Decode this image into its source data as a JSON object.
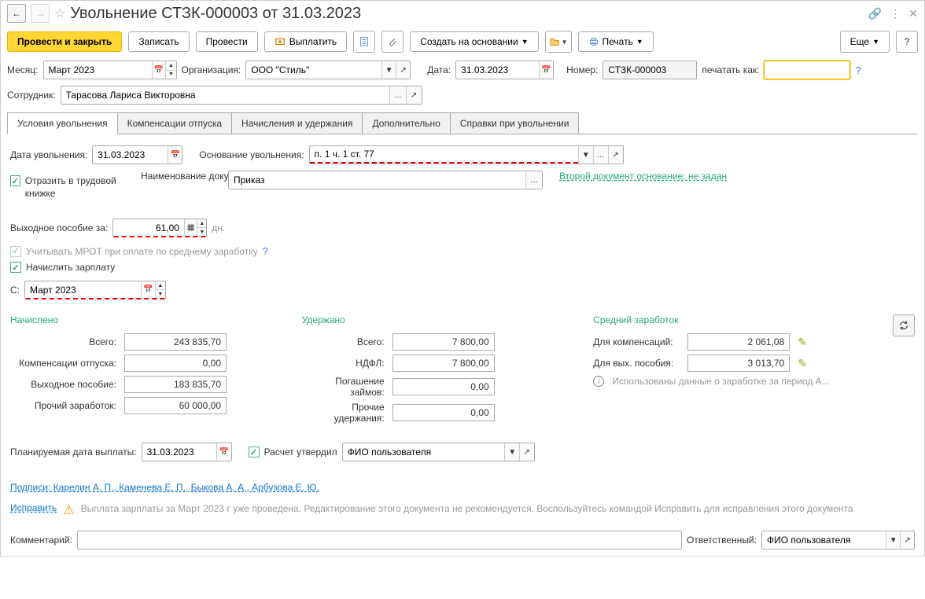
{
  "title": "Увольнение СТЗК-000003 от 31.03.2023",
  "toolbar": {
    "post_close": "Провести и закрыть",
    "save": "Записать",
    "post": "Провести",
    "pay": "Выплатить",
    "create_based": "Создать на основании",
    "print": "Печать",
    "more": "Еще"
  },
  "header": {
    "month_label": "Месяц:",
    "month_value": "Март 2023",
    "org_label": "Организация:",
    "org_value": "ООО \"Стиль\"",
    "date_label": "Дата:",
    "date_value": "31.03.2023",
    "number_label": "Номер:",
    "number_value": "СТЗК-000003",
    "print_as_label": "печатать как:",
    "print_as_value": "",
    "employee_label": "Сотрудник:",
    "employee_value": "Тарасова Лариса Викторовна"
  },
  "tabs": [
    "Условия увольнения",
    "Компенсации отпуска",
    "Начисления и удержания",
    "Дополнительно",
    "Справки при увольнении"
  ],
  "conditions": {
    "dismiss_date_label": "Дата увольнения:",
    "dismiss_date_value": "31.03.2023",
    "basis_label": "Основание увольнения:",
    "basis_value": "п. 1 ч. 1 ст. 77",
    "workbook_label": "Отразить в трудовой книжке",
    "docname_label": "Наименование документа:",
    "docname_value": "Приказ",
    "second_doc_link": "Второй документ основание: не задан",
    "severance_label": "Выходное пособие за:",
    "severance_value": "61,00",
    "days_suffix": "дн.",
    "mrot_label": "Учитывать МРОТ при оплате по среднему заработку",
    "accrue_salary_label": "Начислить зарплату",
    "from_label": "С:",
    "from_value": "Март 2023"
  },
  "summary": {
    "accrued_header": "Начислено",
    "withheld_header": "Удержано",
    "average_header": "Средний заработок",
    "total_label": "Всего:",
    "accrued_total": "243 835,70",
    "vacation_comp_label": "Компенсации отпуска:",
    "vacation_comp": "0,00",
    "severance_label": "Выходное пособие:",
    "severance": "183 835,70",
    "other_label": "Прочий заработок:",
    "other": "60 000,00",
    "withheld_total": "7 800,00",
    "ndfl_label": "НДФЛ:",
    "ndfl": "7 800,00",
    "loan_label": "Погашение займов:",
    "loan": "0,00",
    "other_withhold_label": "Прочие удержания:",
    "other_withhold": "0,00",
    "for_comp_label": "Для компенсаций:",
    "for_comp": "2 061,08",
    "for_sev_label": "Для вых. пособия:",
    "for_sev": "3 013,70",
    "info_text": "Использованы данные о заработке за период А...",
    "planned_date_label": "Планируемая дата выплаты:",
    "planned_date": "31.03.2023",
    "approved_label": "Расчет утвердил",
    "approved_by": "ФИО пользователя"
  },
  "footer": {
    "signatures": "Подписи: Карелин А. П., Каменева Е. П., Быкова А. А., Арбузова Е. Ю.",
    "fix_link": "Исправить",
    "warning": "Выплата зарплаты за Март 2023 г уже проведена. Редактирование этого документа не рекомендуется. Воспользуйтесь командой Исправить для исправления этого документа",
    "comment_label": "Комментарий:",
    "responsible_label": "Ответственный:",
    "responsible_value": "ФИО пользователя"
  }
}
